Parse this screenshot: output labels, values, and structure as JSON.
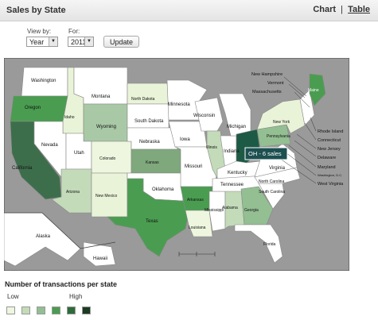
{
  "header": {
    "title": "Sales by State",
    "view_chart": "Chart",
    "separator": "|",
    "view_table": "Table"
  },
  "controls": {
    "view_by_label": "View by:",
    "view_by_value": "Year",
    "for_label": "For:",
    "for_value": "2011",
    "update_label": "Update"
  },
  "tooltip": {
    "text": "OH - 6 sales"
  },
  "legend": {
    "title": "Number of transactions per state",
    "low": "Low",
    "high": "High",
    "colors": [
      "#eef6df",
      "#c3dbb9",
      "#93bf93",
      "#4a9d50",
      "#2d6b3a",
      "#1d3a22"
    ]
  },
  "map": {
    "states": [
      {
        "name": "Washington",
        "fill": "#ffffff"
      },
      {
        "name": "Oregon",
        "fill": "#4a9d50"
      },
      {
        "name": "California",
        "fill": "#3d6e4b"
      },
      {
        "name": "Idaho",
        "fill": "#e9f3d8"
      },
      {
        "name": "Montana",
        "fill": "#ffffff"
      },
      {
        "name": "North Dakota",
        "fill": "#e9f3d8"
      },
      {
        "name": "Minnesota",
        "fill": "#ffffff"
      },
      {
        "name": "South Dakota",
        "fill": "#ffffff"
      },
      {
        "name": "Wyoming",
        "fill": "#a9c9a6"
      },
      {
        "name": "Nebraska",
        "fill": "#ffffff"
      },
      {
        "name": "Iowa",
        "fill": "#ffffff"
      },
      {
        "name": "Wisconsin",
        "fill": "#ffffff"
      },
      {
        "name": "Michigan",
        "fill": "#ffffff"
      },
      {
        "name": "Illinois",
        "fill": "#c3dbb9"
      },
      {
        "name": "Indiana",
        "fill": "#ffffff"
      },
      {
        "name": "Ohio",
        "fill": "#1d5a45"
      },
      {
        "name": "Pennsylvania",
        "fill": "#93bf93"
      },
      {
        "name": "New York",
        "fill": "#e9f3d8"
      },
      {
        "name": "Nevada",
        "fill": "#ffffff"
      },
      {
        "name": "Utah",
        "fill": "#ffffff"
      },
      {
        "name": "Colorado",
        "fill": "#eef6df"
      },
      {
        "name": "Kansas",
        "fill": "#7fa87d"
      },
      {
        "name": "Missouri",
        "fill": "#ffffff"
      },
      {
        "name": "Kentucky",
        "fill": "#ffffff"
      },
      {
        "name": "Virginia",
        "fill": "#ffffff"
      },
      {
        "name": "Arizona",
        "fill": "#c3dbb9"
      },
      {
        "name": "New Mexico",
        "fill": "#e9f3d8"
      },
      {
        "name": "Oklahoma",
        "fill": "#ffffff"
      },
      {
        "name": "Arkansas",
        "fill": "#4a9d50"
      },
      {
        "name": "Tennessee",
        "fill": "#ffffff"
      },
      {
        "name": "North Carolina",
        "fill": "#ffffff"
      },
      {
        "name": "South Carolina",
        "fill": "#ffffff"
      },
      {
        "name": "Texas",
        "fill": "#4a9d50"
      },
      {
        "name": "Louisiana",
        "fill": "#eef6df"
      },
      {
        "name": "Mississippi",
        "fill": "#ffffff"
      },
      {
        "name": "Alabama",
        "fill": "#c3dbb9"
      },
      {
        "name": "Georgia",
        "fill": "#93bf93"
      },
      {
        "name": "Florida",
        "fill": "#ffffff"
      },
      {
        "name": "Maine",
        "fill": "#4a9d50"
      },
      {
        "name": "Alaska",
        "fill": "#ffffff"
      },
      {
        "name": "Hawaii",
        "fill": "#ffffff"
      }
    ],
    "callouts": [
      "New Hampshire",
      "Vermont",
      "Massachusetts",
      "Rhode Island",
      "Connecticut",
      "New Jersey",
      "Delaware",
      "Maryland",
      "Washington, D.C.",
      "West Virginia"
    ]
  }
}
